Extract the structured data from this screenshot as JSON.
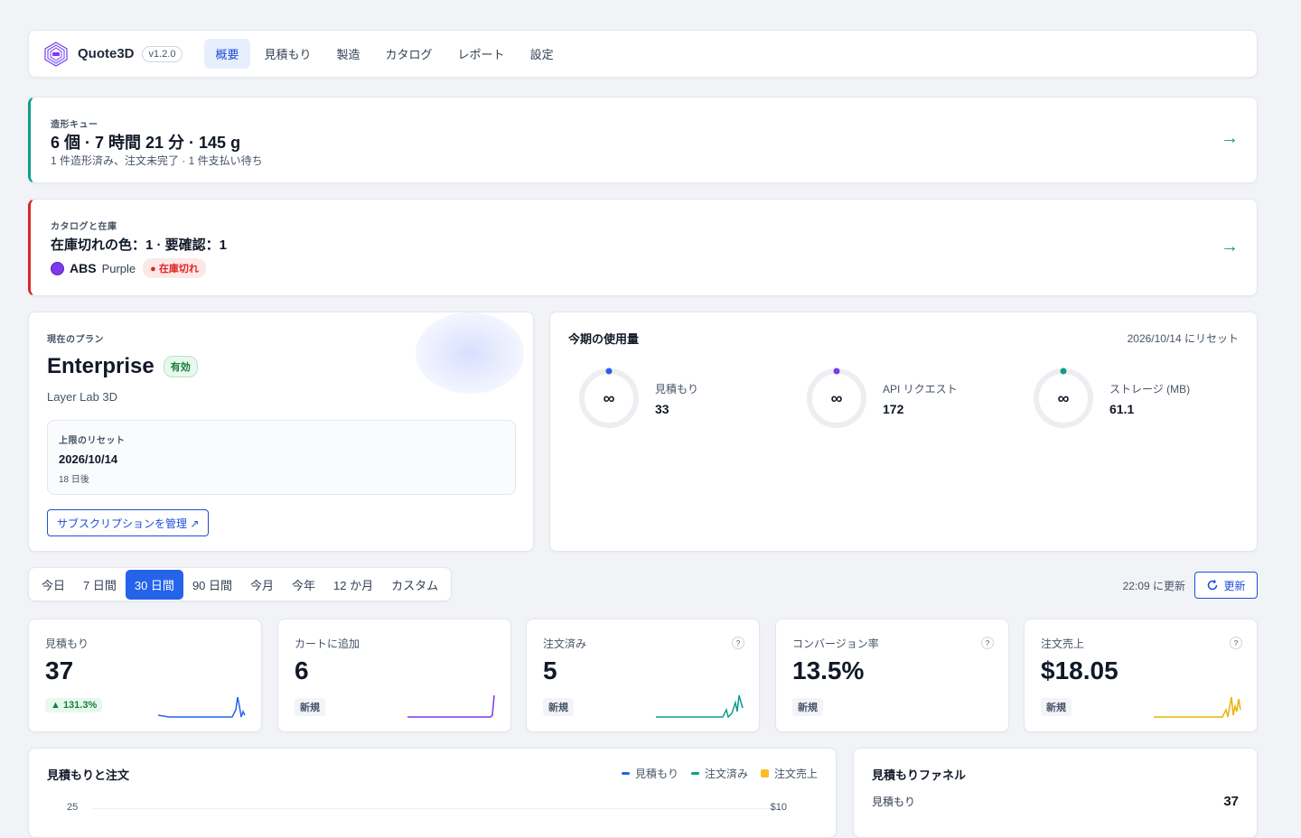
{
  "nav": {
    "brand": "Quote3D",
    "version": "v1.2.0",
    "tabs": [
      "概要",
      "見積もり",
      "製造",
      "カタログ",
      "レポート",
      "設定"
    ],
    "active_tab": "概要"
  },
  "queue_banner": {
    "label": "造形キュー",
    "title": "6 個 · 7 時間 21 分 · 145 g",
    "subtitle": "1 件造形済み、注文未完了 · 1 件支払い待ち",
    "accent": "#0f9d8a"
  },
  "catalog_banner": {
    "label": "カタログと在庫",
    "title": "在庫切れの色：1 · 要確認：1",
    "material": "ABS",
    "color_name": "Purple",
    "status": "在庫切れ",
    "accent": "#dc2626"
  },
  "plan": {
    "label": "現在のプラン",
    "name": "Enterprise",
    "status": "有効",
    "org": "Layer Lab 3D",
    "reset_label": "上限のリセット",
    "reset_date": "2026/10/14",
    "reset_in": "18 日後",
    "manage_button": "サブスクリプションを管理 ↗"
  },
  "usage": {
    "title": "今期の使用量",
    "reset_note": "2026/10/14 にリセット",
    "items": [
      {
        "label": "見積もり",
        "value": "33",
        "limit": "∞",
        "color": "#2563eb"
      },
      {
        "label": "API リクエスト",
        "value": "172",
        "limit": "∞",
        "color": "#7c3aed"
      },
      {
        "label": "ストレージ (MB)",
        "value": "61.1",
        "limit": "∞",
        "color": "#0f9d8a"
      }
    ]
  },
  "range": {
    "options": [
      "今日",
      "7 日間",
      "30 日間",
      "90 日間",
      "今月",
      "今年",
      "12 か月",
      "カスタム"
    ],
    "active": "30 日間",
    "updated": "22:09 に更新",
    "refresh_label": "更新"
  },
  "kpis": [
    {
      "label": "見積もり",
      "value": "37",
      "badge": "▲ 131.3%",
      "badge_type": "up",
      "help": false,
      "color": "#2563eb"
    },
    {
      "label": "カートに追加",
      "value": "6",
      "badge": "新規",
      "badge_type": "new",
      "help": false,
      "color": "#7c3aed"
    },
    {
      "label": "注文済み",
      "value": "5",
      "badge": "新規",
      "badge_type": "new",
      "help": true,
      "color": "#0f9d8a"
    },
    {
      "label": "コンバージョン率",
      "value": "13.5%",
      "badge": "新規",
      "badge_type": "new",
      "help": true,
      "color": "#0f9d8a"
    },
    {
      "label": "注文売上",
      "value": "$18.05",
      "badge": "新規",
      "badge_type": "new",
      "help": true,
      "color": "#eab308"
    }
  ],
  "help_glyph": "?",
  "chart": {
    "title": "見積もりと注文",
    "legend": [
      {
        "name": "見積もり",
        "color": "#2563eb",
        "kind": "line"
      },
      {
        "name": "注文済み",
        "color": "#0f9d8a",
        "kind": "line"
      },
      {
        "name": "注文売上",
        "color": "#fbbf24",
        "kind": "bar"
      }
    ],
    "y_left_top": "25",
    "y_right_top": "$10"
  },
  "funnel": {
    "title": "見積もりファネル",
    "rows": [
      {
        "label": "見積もり",
        "value": "37"
      }
    ]
  }
}
